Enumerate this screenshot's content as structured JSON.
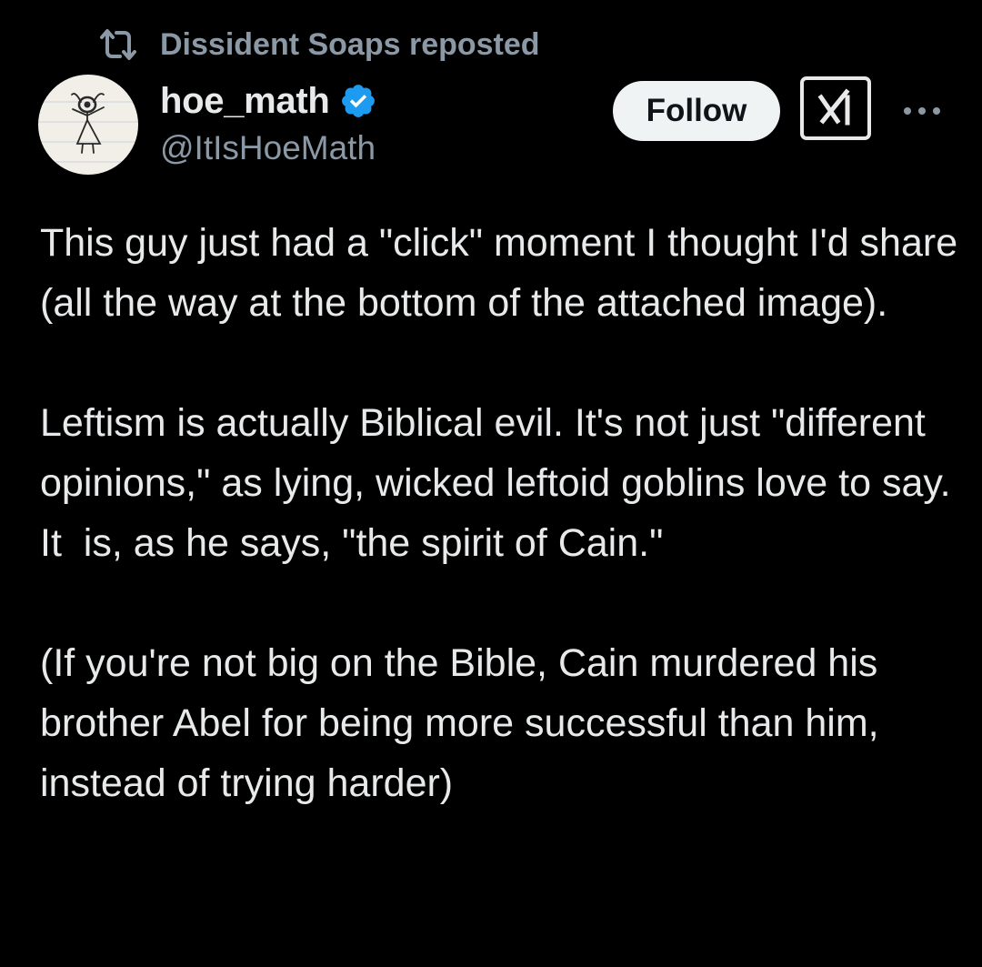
{
  "repost": {
    "icon": "repost-icon",
    "text": "Dissident Soaps reposted"
  },
  "author": {
    "display_name": "hoe_math",
    "handle": "@ItIsHoeMath",
    "avatar_icon": "stick-figure-drawing-avatar",
    "verified_icon": "verified-badge-icon",
    "verified_color": "#1d9bf0"
  },
  "actions": {
    "follow_label": "Follow",
    "grok_icon": "grok-icon",
    "more_icon": "more-dots-icon"
  },
  "tweet": {
    "paragraphs": [
      "This guy just had a \"click\" moment I thought I'd share (all the way at the bottom of the attached image).",
      "Leftism is actually Biblical evil. It's not just \"different opinions,\" as lying, wicked leftoid goblins love to say. It  is, as he says, \"the spirit of Cain.\"",
      "(If you're not big on the Bible, Cain murdered his brother Abel for being more successful than him, instead of trying harder)"
    ]
  },
  "colors": {
    "background": "#000000",
    "text_primary": "#e7e9ea",
    "text_secondary": "#8b98a5",
    "follow_bg": "#eff3f4"
  }
}
